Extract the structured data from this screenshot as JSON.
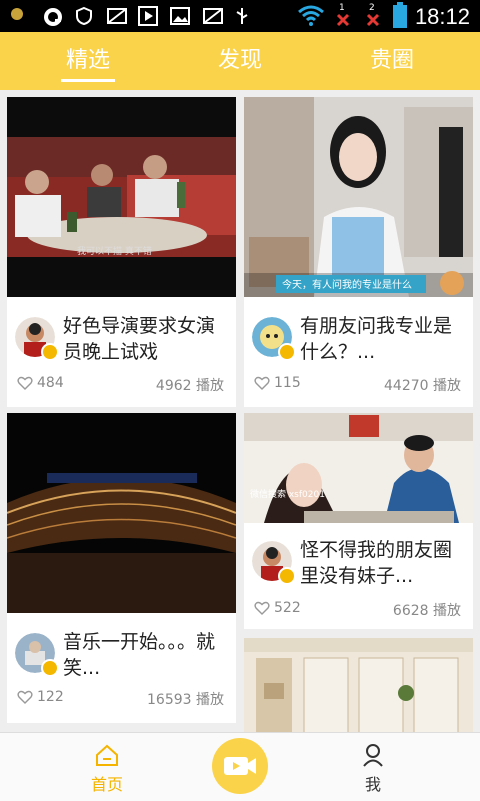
{
  "status_bar": {
    "time": "18:12",
    "sim1_badge": "1",
    "sim2_badge": "2"
  },
  "tabs": [
    {
      "label": "精选",
      "active": true
    },
    {
      "label": "发现",
      "active": false
    },
    {
      "label": "贵圈",
      "active": false
    }
  ],
  "feed": [
    {
      "title": "好色导演要求女演员晚上试戏",
      "likes": "484",
      "plays": "4962 播放",
      "thumb_caption": "我可以不描  真不错"
    },
    {
      "title": "有朋友问我专业是什么？...",
      "likes": "115",
      "plays": "44270 播放",
      "thumb_caption": "今天，有人问我的专业是什么"
    },
    {
      "title": "音乐一开始。。。就笑...",
      "likes": "122",
      "plays": "16593 播放"
    },
    {
      "title": "怪不得我的朋友圈里没有妹子...",
      "likes": "522",
      "plays": "6628 播放",
      "thumb_caption": "微信搜索 xsf0201"
    }
  ],
  "bottom_nav": {
    "home_label": "首页",
    "me_label": "我"
  },
  "colors": {
    "accent": "#fbd34a",
    "status_bar": "#000000",
    "home_active": "#f4b400"
  }
}
